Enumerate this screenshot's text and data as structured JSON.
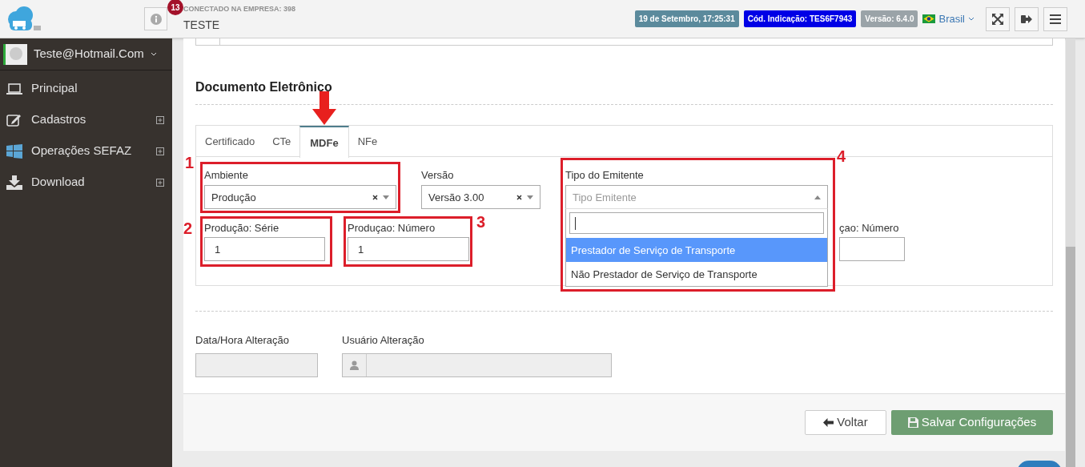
{
  "header": {
    "notification_count": "13",
    "company_label": "CONECTADO NA EMPRESA: 398",
    "company": "TESTE",
    "badges": [
      {
        "text": "19 de Setembro, 17:25:31",
        "color": "#5b8a9c"
      },
      {
        "text": "Cód. Indicação: TES6F7943",
        "color": "#0000e6"
      },
      {
        "text": "Versão: 6.4.0",
        "color": "#9aa3a8"
      }
    ],
    "language": "Brasil"
  },
  "sidebar": {
    "user": "Teste@Hotmail.Com",
    "items": [
      {
        "label": "Principal",
        "kind": "laptop",
        "expandable": false
      },
      {
        "label": "Cadastros",
        "kind": "edit",
        "expandable": true
      },
      {
        "label": "Operações SEFAZ",
        "kind": "windows",
        "expandable": true
      },
      {
        "label": "Download",
        "kind": "download",
        "expandable": true
      }
    ]
  },
  "section_title": "Documento Eletrônico",
  "tabs": [
    {
      "label": "Certificado",
      "selected": false
    },
    {
      "label": "CTe",
      "selected": false
    },
    {
      "label": "MDFe",
      "selected": true
    },
    {
      "label": "NFe",
      "selected": false
    }
  ],
  "row1": [
    {
      "label": "Ambiente",
      "value": "Produção",
      "expanded": false
    },
    {
      "label": "Versão",
      "value": "Versão 3.00",
      "expanded": false
    },
    {
      "label": "Tipo do Emitente",
      "placeholder": "Tipo Emitente",
      "expanded": true
    }
  ],
  "row2": [
    {
      "label": "Produção: Série",
      "value": "1"
    },
    {
      "label": "Produçao: Número",
      "value": "1"
    },
    {
      "label": "çao: Número"
    }
  ],
  "dropdown_options": [
    {
      "label": "Prestador de Serviço de Transporte",
      "selected": true
    },
    {
      "label": "Não Prestador de Serviço de Transporte",
      "selected": false
    }
  ],
  "audit": [
    {
      "label": "Data/Hora Alteração",
      "kind": "text"
    },
    {
      "label": "Usuário Alteração",
      "kind": "user"
    }
  ],
  "buttons": [
    {
      "label": "Voltar",
      "kind": "back"
    },
    {
      "label": "Salvar Configurações",
      "kind": "save"
    }
  ],
  "annotations": [
    "1",
    "2",
    "3",
    "4"
  ]
}
